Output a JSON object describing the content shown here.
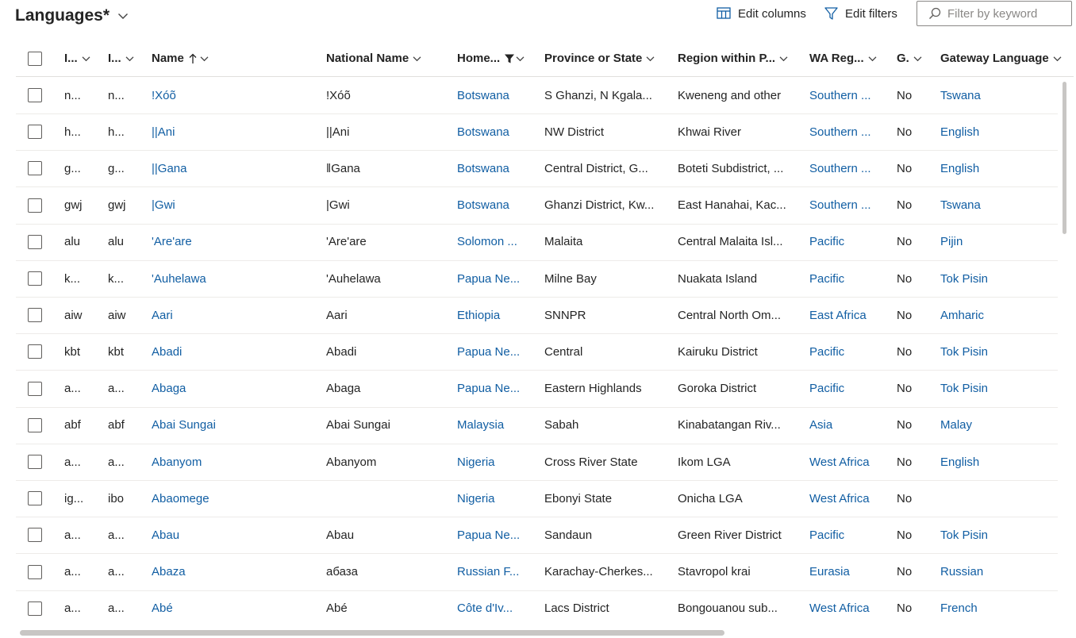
{
  "header": {
    "title": "Languages*",
    "edit_columns": "Edit columns",
    "edit_filters": "Edit filters",
    "filter_placeholder": "Filter by keyword"
  },
  "columns": [
    {
      "label": "I...",
      "icon": "chevron-down-icon"
    },
    {
      "label": "I...",
      "icon": "chevron-down-icon"
    },
    {
      "label": "Name",
      "icon": "sort-ascending-icon"
    },
    {
      "label": "National Name",
      "icon": "chevron-down-icon"
    },
    {
      "label": "Home...",
      "icon": "filter-icon"
    },
    {
      "label": "Province or State",
      "icon": "chevron-down-icon"
    },
    {
      "label": "Region within P...",
      "icon": "chevron-down-icon"
    },
    {
      "label": "WA Reg...",
      "icon": "chevron-down-icon"
    },
    {
      "label": "G.",
      "icon": "chevron-down-icon"
    },
    {
      "label": "Gateway Language",
      "icon": "chevron-down-icon"
    }
  ],
  "rows": [
    {
      "c1": "n...",
      "c2": "n...",
      "name": "!Xóõ",
      "national": "!Xóõ",
      "home": "Botswana",
      "province": "S Ghanzi, N Kgala...",
      "region": "Kweneng and other",
      "wa": "Southern ...",
      "g": "No",
      "gateway": "Tswana"
    },
    {
      "c1": "h...",
      "c2": "h...",
      "name": "||Ani",
      "national": "||Ani",
      "home": "Botswana",
      "province": "NW District",
      "region": "Khwai River",
      "wa": "Southern ...",
      "g": "No",
      "gateway": "English"
    },
    {
      "c1": "g...",
      "c2": "g...",
      "name": "||Gana",
      "national": "ǁGana",
      "home": "Botswana",
      "province": "Central District, G...",
      "region": "Boteti Subdistrict, ...",
      "wa": "Southern ...",
      "g": "No",
      "gateway": "English"
    },
    {
      "c1": "gwj",
      "c2": "gwj",
      "name": "|Gwi",
      "national": "|Gwi",
      "home": "Botswana",
      "province": "Ghanzi District, Kw...",
      "region": "East Hanahai, Kac...",
      "wa": "Southern ...",
      "g": "No",
      "gateway": "Tswana"
    },
    {
      "c1": "alu",
      "c2": "alu",
      "name": "'Are'are",
      "national": "'Are'are",
      "home": "Solomon ...",
      "province": "Malaita",
      "region": "Central Malaita Isl...",
      "wa": "Pacific",
      "g": "No",
      "gateway": "Pijin"
    },
    {
      "c1": "k...",
      "c2": "k...",
      "name": "'Auhelawa",
      "national": "'Auhelawa",
      "home": "Papua Ne...",
      "province": "Milne Bay",
      "region": "Nuakata Island",
      "wa": "Pacific",
      "g": "No",
      "gateway": "Tok Pisin"
    },
    {
      "c1": "aiw",
      "c2": "aiw",
      "name": "Aari",
      "national": "Aari",
      "home": "Ethiopia",
      "province": "SNNPR",
      "region": "Central North Om...",
      "wa": "East Africa",
      "g": "No",
      "gateway": "Amharic"
    },
    {
      "c1": "kbt",
      "c2": "kbt",
      "name": "Abadi",
      "national": "Abadi",
      "home": "Papua Ne...",
      "province": "Central",
      "region": "Kairuku District",
      "wa": "Pacific",
      "g": "No",
      "gateway": "Tok Pisin"
    },
    {
      "c1": "a...",
      "c2": "a...",
      "name": "Abaga",
      "national": "Abaga",
      "home": "Papua Ne...",
      "province": "Eastern Highlands",
      "region": "Goroka District",
      "wa": "Pacific",
      "g": "No",
      "gateway": "Tok Pisin"
    },
    {
      "c1": "abf",
      "c2": "abf",
      "name": "Abai Sungai",
      "national": "Abai Sungai",
      "home": "Malaysia",
      "province": "Sabah",
      "region": "Kinabatangan Riv...",
      "wa": "Asia",
      "g": "No",
      "gateway": "Malay"
    },
    {
      "c1": "a...",
      "c2": "a...",
      "name": "Abanyom",
      "national": "Abanyom",
      "home": "Nigeria",
      "province": "Cross River State",
      "region": "Ikom LGA",
      "wa": "West Africa",
      "g": "No",
      "gateway": "English"
    },
    {
      "c1": "ig...",
      "c2": "ibo",
      "name": "Abaomege",
      "national": "",
      "home": "Nigeria",
      "province": "Ebonyi State",
      "region": "Onicha LGA",
      "wa": "West Africa",
      "g": "No",
      "gateway": ""
    },
    {
      "c1": "a...",
      "c2": "a...",
      "name": "Abau",
      "national": "Abau",
      "home": "Papua Ne...",
      "province": "Sandaun",
      "region": "Green River District",
      "wa": "Pacific",
      "g": "No",
      "gateway": "Tok Pisin"
    },
    {
      "c1": "a...",
      "c2": "a...",
      "name": "Abaza",
      "national": "абаза",
      "home": "Russian F...",
      "province": "Karachay-Cherkes...",
      "region": "Stavropol krai",
      "wa": "Eurasia",
      "g": "No",
      "gateway": "Russian"
    },
    {
      "c1": "a...",
      "c2": "a...",
      "name": "Abé",
      "national": "Abé",
      "home": "Côte d'Iv...",
      "province": "Lacs District",
      "region": "Bongouanou sub...",
      "wa": "West Africa",
      "g": "No",
      "gateway": "French"
    }
  ]
}
